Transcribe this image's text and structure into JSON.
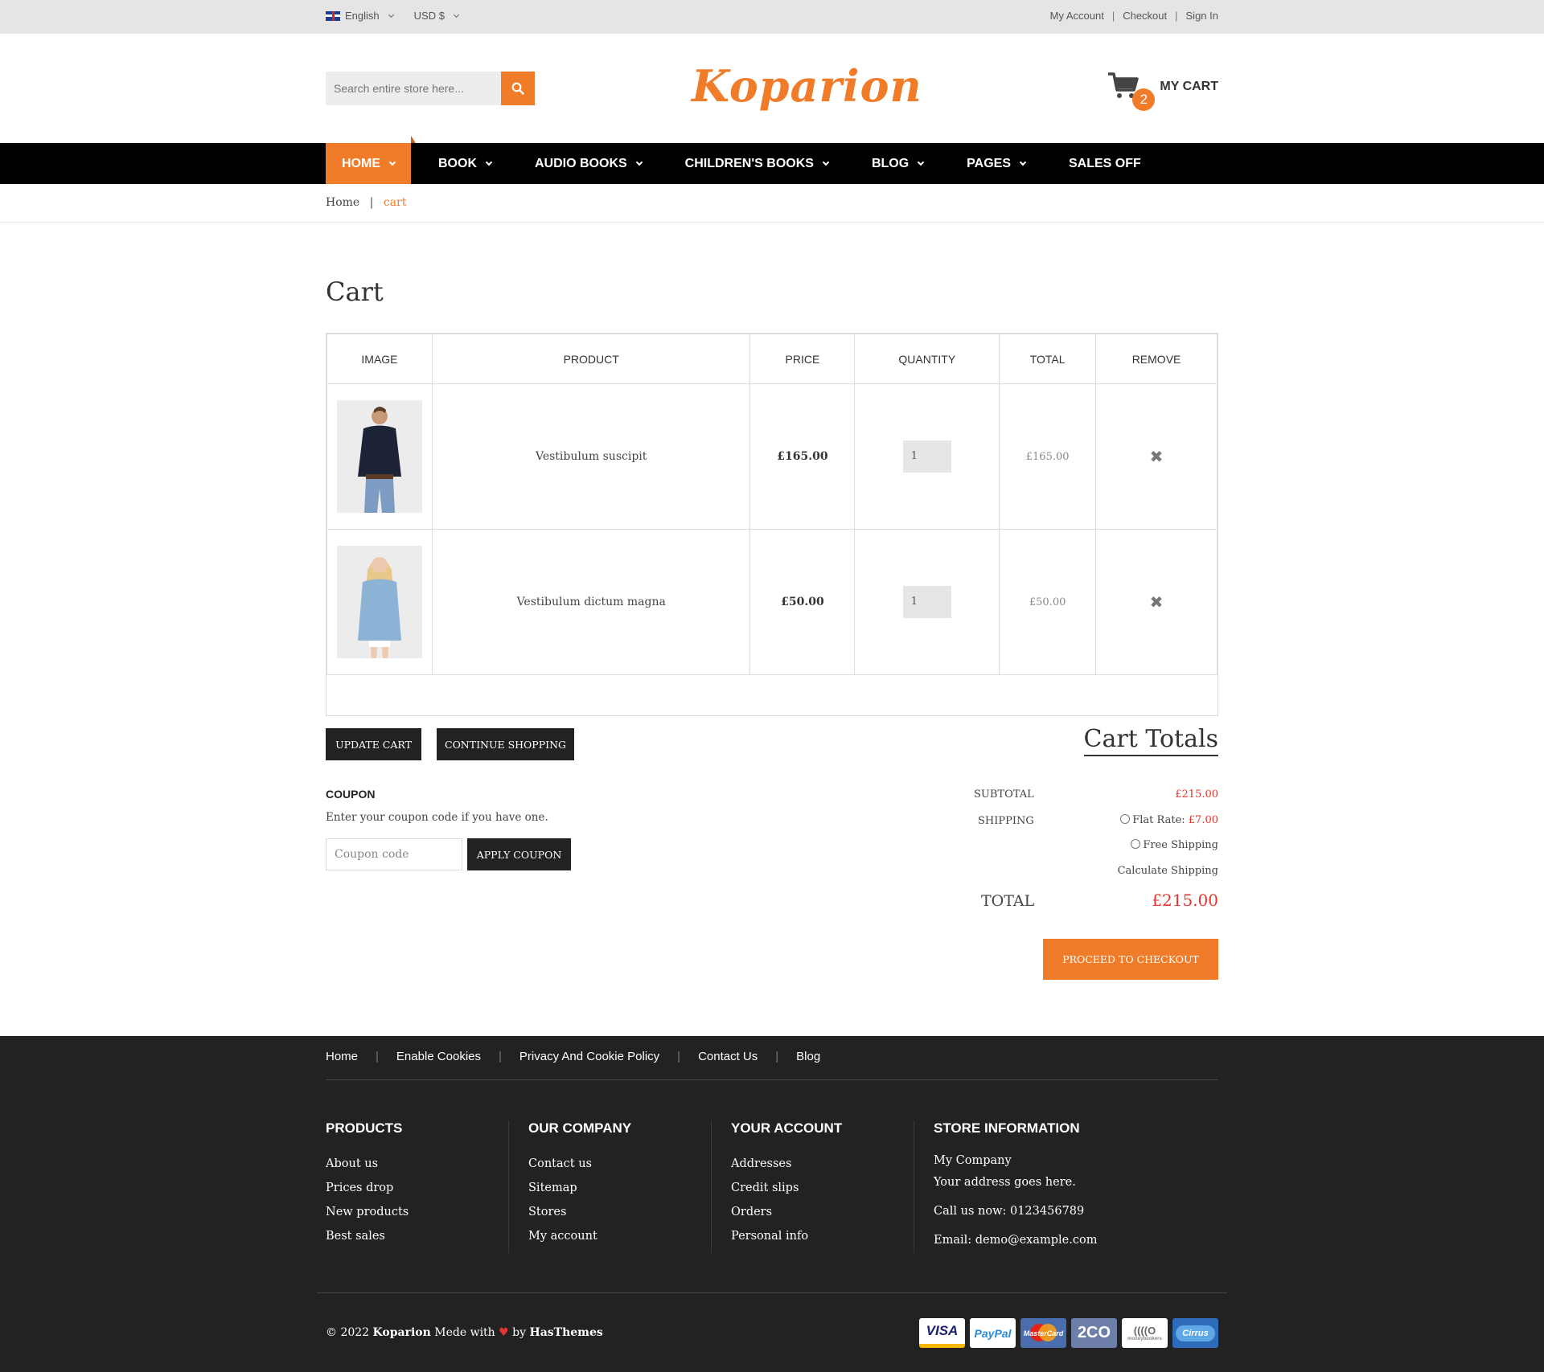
{
  "topbar": {
    "language": "English",
    "currency": "USD $",
    "links": [
      "My Account",
      "Checkout",
      "Sign In"
    ]
  },
  "header": {
    "search_placeholder": "Search entire store here...",
    "logo": "Koparion",
    "cart_count": "2",
    "cart_label": "MY CART"
  },
  "nav": {
    "items": [
      "HOME",
      "BOOK",
      "AUDIO BOOKS",
      "CHILDREN'S BOOKS",
      "BLOG",
      "PAGES",
      "SALES OFF"
    ]
  },
  "breadcrumb": {
    "home": "Home",
    "sep": "|",
    "current": "cart"
  },
  "page_title": "Cart",
  "cart_table": {
    "headers": [
      "IMAGE",
      "PRODUCT",
      "PRICE",
      "QUANTITY",
      "TOTAL",
      "REMOVE"
    ],
    "rows": [
      {
        "product": "Vestibulum suscipit",
        "price": "£165.00",
        "quantity": "1",
        "total": "£165.00"
      },
      {
        "product": "Vestibulum dictum magna",
        "price": "£50.00",
        "quantity": "1",
        "total": "£50.00"
      }
    ]
  },
  "actions": {
    "update": "UPDATE CART",
    "continue": "CONTINUE SHOPPING"
  },
  "coupon": {
    "heading": "COUPON",
    "text": "Enter your coupon code if you have one.",
    "placeholder": "Coupon code",
    "button": "APPLY COUPON"
  },
  "totals": {
    "title": "Cart Totals",
    "subtotal_label": "SUBTOTAL",
    "subtotal": "£215.00",
    "shipping_label": "SHIPPING",
    "flat_rate": "Flat Rate:",
    "flat_rate_price": "£7.00",
    "free_shipping": "Free Shipping",
    "calculate": "Calculate Shipping",
    "total_label": "TOTAL",
    "total": "£215.00",
    "checkout": "PROCEED TO CHECKOUT"
  },
  "footer": {
    "links": [
      "Home",
      "Enable Cookies",
      "Privacy And Cookie Policy",
      "Contact Us",
      "Blog"
    ],
    "columns": [
      {
        "title": "PRODUCTS",
        "items": [
          "About us",
          "Prices drop",
          "New products",
          "Best sales"
        ]
      },
      {
        "title": "OUR COMPANY",
        "items": [
          "Contact us",
          "Sitemap",
          "Stores",
          "My account"
        ]
      },
      {
        "title": "YOUR ACCOUNT",
        "items": [
          "Addresses",
          "Credit slips",
          "Orders",
          "Personal info"
        ]
      }
    ],
    "store": {
      "title": "STORE INFORMATION",
      "company": "My Company",
      "address": "Your address goes here.",
      "phone": "Call us now: 0123456789",
      "email": "Email: demo@example.com"
    },
    "copyright_pre": "© 2022",
    "brand": "Koparion",
    "made": "Mede with",
    "by": "by",
    "author": "HasThemes",
    "payments": [
      "VISA",
      "PayPal",
      "MasterCard",
      "2CO",
      "moneybookers",
      "Cirrus"
    ]
  },
  "colors": {
    "accent": "#f07c29",
    "dark": "#222222",
    "price_red": "#e5352c"
  }
}
